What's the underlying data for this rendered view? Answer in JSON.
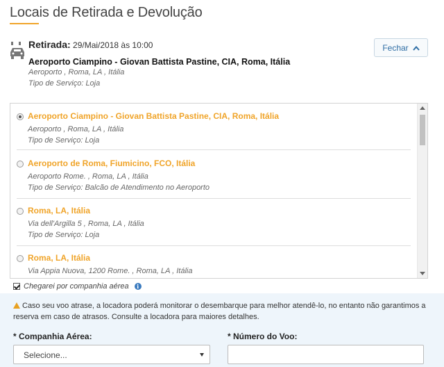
{
  "page": {
    "title": "Locais de Retirada e Devolução",
    "accent_color": "#f0a429"
  },
  "pickup": {
    "label": "Retirada:",
    "datetime": "29/Mai/2018 às 10:00",
    "location": "Aeroporto Ciampino - Giovan Battista Pastine, CIA, Roma, Itália",
    "address": "Aeroporto , Roma, LA , Itália",
    "service": "Tipo de Serviço: Loja",
    "icon": "car-icon"
  },
  "close_button": {
    "label": "Fechar",
    "icon": "chevron-up-icon"
  },
  "locations": [
    {
      "name": "Aeroporto Ciampino - Giovan Battista Pastine, CIA, Roma, Itália",
      "address": "Aeroporto , Roma, LA , Itália",
      "service": "Tipo de Serviço: Loja",
      "selected": true
    },
    {
      "name": "Aeroporto de Roma, Fiumicino, FCO, Itália",
      "address": "Aeroporto Rome. , Roma, LA , Itália",
      "service": "Tipo de Serviço: Balcão de Atendimento no Aeroporto",
      "selected": false
    },
    {
      "name": "Roma, LA, Itália",
      "address": "Via dell'Argilla 5 , Roma, LA , Itália",
      "service": "Tipo de Serviço: Loja",
      "selected": false
    },
    {
      "name": "Roma, LA, Itália",
      "address": "Via Appia Nuova, 1200 Rome. , Roma, LA , Itália",
      "service": "",
      "selected": false
    }
  ],
  "airline_checkbox": {
    "label": "Chegarei por companhia aérea",
    "checked": true,
    "info_icon": "i"
  },
  "warning": {
    "text": "Caso seu voo atrase, a locadora poderá monitorar o desembarque para melhor atendê-lo, no entanto não garantimos a reserva em caso de atrasos. Consulte a locadora para maiores detalhes."
  },
  "form": {
    "airline_label": "* Companhia Aérea:",
    "airline_value": "Selecione...",
    "flight_label": "* Número do Voo:",
    "flight_value": ""
  }
}
